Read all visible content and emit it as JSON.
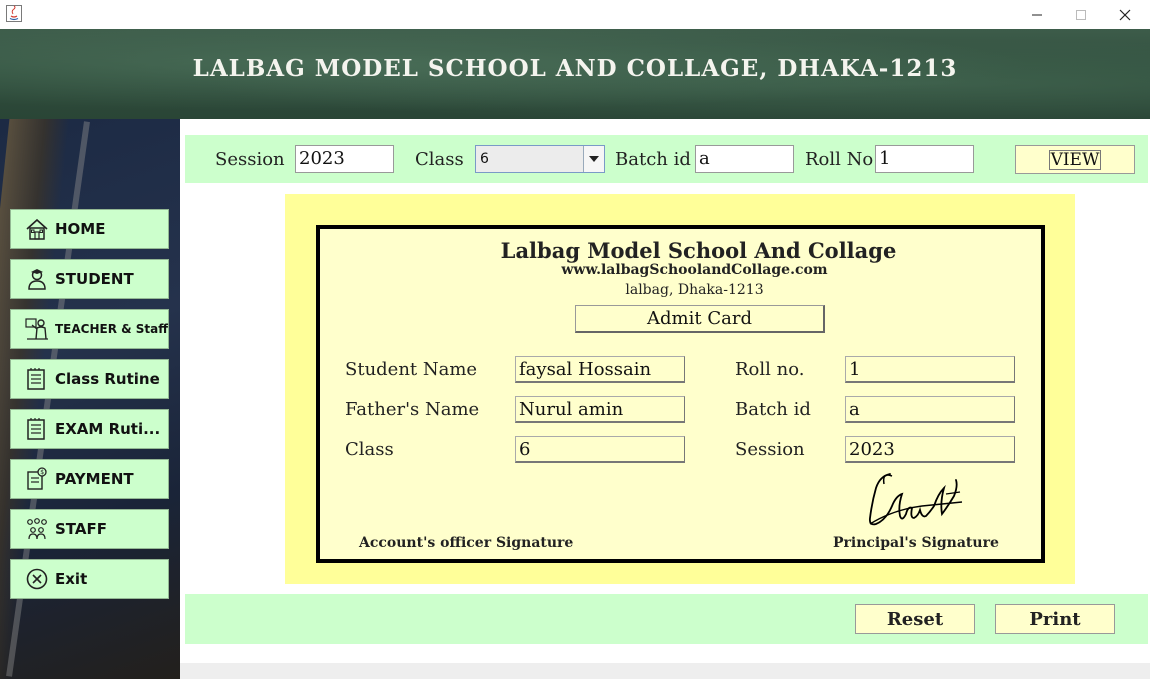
{
  "window": {
    "title": ""
  },
  "header": {
    "title": "LALBAG MODEL SCHOOL AND COLLAGE, DHAKA-1213"
  },
  "sidebar": {
    "items": [
      {
        "label": "HOME",
        "icon": "home-icon"
      },
      {
        "label": "STUDENT",
        "icon": "student-icon"
      },
      {
        "label": "TEACHER & Staff",
        "icon": "teacher-icon"
      },
      {
        "label": "Class Rutine",
        "icon": "routine-icon"
      },
      {
        "label": "EXAM Ruti...",
        "icon": "exam-routine-icon"
      },
      {
        "label": "PAYMENT",
        "icon": "payment-icon"
      },
      {
        "label": "STAFF",
        "icon": "staff-icon"
      },
      {
        "label": "Exit",
        "icon": "exit-icon"
      }
    ]
  },
  "filter": {
    "session_label": "Session",
    "session_value": "2023",
    "class_label": "Class",
    "class_value": "6",
    "batch_label": "Batch id",
    "batch_value": "a",
    "roll_label": "Roll No",
    "roll_value": "1",
    "view_label": "VIEW"
  },
  "card": {
    "school_name": "Lalbag Model School And Collage",
    "website": "www.lalbagSchoolandCollage.com",
    "address": "lalbag, Dhaka-1213",
    "heading": "Admit Card",
    "student_name_label": "Student Name",
    "student_name": "faysal Hossain",
    "father_name_label": "Father's Name",
    "father_name": "Nurul amin",
    "class_label": "Class",
    "class": "6",
    "roll_label": "Roll no.",
    "roll": "1",
    "batch_label": "Batch id",
    "batch": "a",
    "session_label": "Session",
    "session": "2023",
    "accounts_signature_label": "Account's officer Signature",
    "principal_signature_label": "Principal's Signature"
  },
  "actions": {
    "reset_label": "Reset",
    "print_label": "Print"
  },
  "colors": {
    "panel_green": "#ccffcc",
    "card_yellow": "#ffffcc",
    "card_border_yellow": "#ffff99",
    "header_board": "#34533f"
  }
}
